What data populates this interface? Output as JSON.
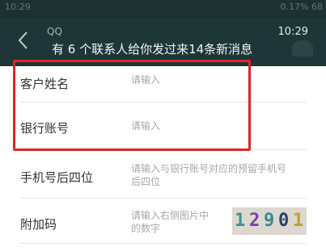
{
  "statusbar": {
    "time": "10:29",
    "net": "0.17%",
    "battery": "68"
  },
  "header": {
    "app": "QQ",
    "message": "有 6 个联系人给你发过来14条新消息",
    "time": "10:29"
  },
  "form": {
    "rows": [
      {
        "label": "客户姓名",
        "placeholder": "请输入"
      },
      {
        "label": "银行账号",
        "placeholder": "请输入"
      },
      {
        "label": "手机号后四位",
        "hint_line1": "请输入与银行账号对应的预留手机号",
        "hint_line2": "后四位"
      },
      {
        "label": "附加码",
        "hint_line1": "请输入右侧图片中",
        "hint_line2": "的数字"
      }
    ]
  },
  "captcha": {
    "digits": [
      "1",
      "2",
      "9",
      "0",
      "1"
    ],
    "colors": [
      "#3f8f95",
      "#7c3ea8",
      "#3c8a8f",
      "#24436b",
      "#bfa128"
    ]
  }
}
